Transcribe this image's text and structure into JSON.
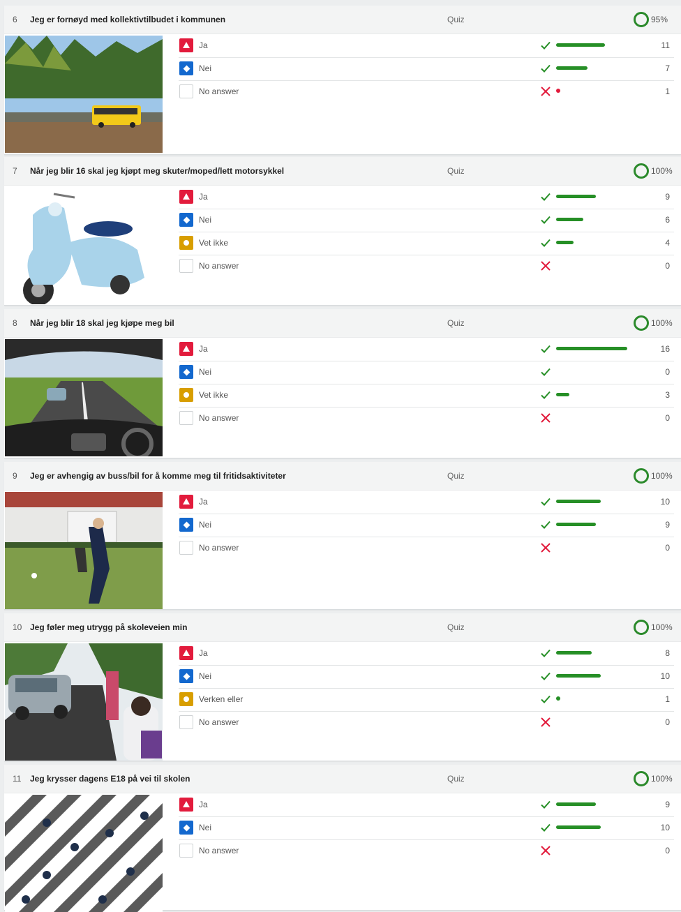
{
  "questions": [
    {
      "number": "6",
      "title": "Jeg er fornøyd med kollektivtilbudet i kommunen",
      "type": "Quiz",
      "percent": "95%",
      "image": "bus-landscape-image",
      "answers": [
        {
          "label": "Ja",
          "shape": "triangle",
          "color": "#e21b3c",
          "correct": true,
          "count": "11",
          "fraction": 1.0
        },
        {
          "label": "Nei",
          "shape": "diamond",
          "color": "#1368ce",
          "correct": true,
          "count": "7",
          "fraction": 0.64
        },
        {
          "label": "No answer",
          "shape": "none",
          "color": "#ffffff",
          "correct": false,
          "count": "1",
          "fraction": 0.09
        }
      ]
    },
    {
      "number": "7",
      "title": "Når jeg blir 16 skal jeg kjøpt meg skuter/moped/lett motorsykkel",
      "type": "Quiz",
      "percent": "100%",
      "image": "scooter-image",
      "answers": [
        {
          "label": "Ja",
          "shape": "triangle",
          "color": "#e21b3c",
          "correct": true,
          "count": "9",
          "fraction": 0.82
        },
        {
          "label": "Nei",
          "shape": "diamond",
          "color": "#1368ce",
          "correct": true,
          "count": "6",
          "fraction": 0.55
        },
        {
          "label": "Vet ikke",
          "shape": "circle",
          "color": "#d89e00",
          "correct": true,
          "count": "4",
          "fraction": 0.36
        },
        {
          "label": "No answer",
          "shape": "none",
          "color": "#ffffff",
          "correct": false,
          "count": "0",
          "fraction": 0
        }
      ]
    },
    {
      "number": "8",
      "title": "Når jeg blir 18 skal jeg kjøpe meg bil",
      "type": "Quiz",
      "percent": "100%",
      "image": "car-dashboard-road-image",
      "answers": [
        {
          "label": "Ja",
          "shape": "triangle",
          "color": "#e21b3c",
          "correct": true,
          "count": "16",
          "fraction": 1.45
        },
        {
          "label": "Nei",
          "shape": "diamond",
          "color": "#1368ce",
          "correct": true,
          "count": "0",
          "fraction": 0
        },
        {
          "label": "Vet ikke",
          "shape": "circle",
          "color": "#d89e00",
          "correct": true,
          "count": "3",
          "fraction": 0.27
        },
        {
          "label": "No answer",
          "shape": "none",
          "color": "#ffffff",
          "correct": false,
          "count": "0",
          "fraction": 0
        }
      ]
    },
    {
      "number": "9",
      "title": "Jeg er avhengig av buss/bil for å komme meg til fritidsaktiviteter",
      "type": "Quiz",
      "percent": "100%",
      "image": "football-field-image",
      "answers": [
        {
          "label": "Ja",
          "shape": "triangle",
          "color": "#e21b3c",
          "correct": true,
          "count": "10",
          "fraction": 0.91
        },
        {
          "label": "Nei",
          "shape": "diamond",
          "color": "#1368ce",
          "correct": true,
          "count": "9",
          "fraction": 0.82
        },
        {
          "label": "No answer",
          "shape": "none",
          "color": "#ffffff",
          "correct": false,
          "count": "0",
          "fraction": 0
        }
      ]
    },
    {
      "number": "10",
      "title": "Jeg føler meg utrygg på skoleveien min",
      "type": "Quiz",
      "percent": "100%",
      "image": "school-road-image",
      "answers": [
        {
          "label": "Ja",
          "shape": "triangle",
          "color": "#e21b3c",
          "correct": true,
          "count": "8",
          "fraction": 0.73
        },
        {
          "label": "Nei",
          "shape": "diamond",
          "color": "#1368ce",
          "correct": true,
          "count": "10",
          "fraction": 0.91
        },
        {
          "label": "Verken eller",
          "shape": "circle",
          "color": "#d89e00",
          "correct": true,
          "count": "1",
          "fraction": 0.09
        },
        {
          "label": "No answer",
          "shape": "none",
          "color": "#ffffff",
          "correct": false,
          "count": "0",
          "fraction": 0
        }
      ]
    },
    {
      "number": "11",
      "title": "Jeg krysser dagens E18 på vei til skolen",
      "type": "Quiz",
      "percent": "100%",
      "image": "crosswalk-image",
      "answers": [
        {
          "label": "Ja",
          "shape": "triangle",
          "color": "#e21b3c",
          "correct": true,
          "count": "9",
          "fraction": 0.82
        },
        {
          "label": "Nei",
          "shape": "diamond",
          "color": "#1368ce",
          "correct": true,
          "count": "10",
          "fraction": 0.91
        },
        {
          "label": "No answer",
          "shape": "none",
          "color": "#ffffff",
          "correct": false,
          "count": "0",
          "fraction": 0
        }
      ]
    }
  ]
}
